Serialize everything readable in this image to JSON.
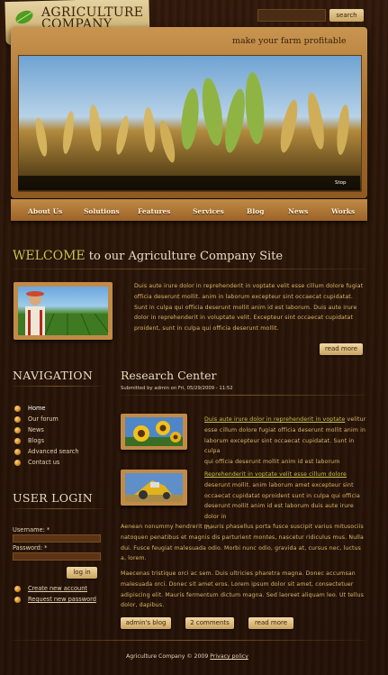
{
  "header": {
    "logo_line1": "AGRICULTURE",
    "logo_line2": "COMPANY",
    "search_label": "search",
    "tagline": "make your farm profitable"
  },
  "banner": {
    "stop_label": "Stop"
  },
  "menu": [
    "About Us",
    "Solutions",
    "Features",
    "Services",
    "Blog",
    "News",
    "Works"
  ],
  "welcome": {
    "highlight": "WELCOME",
    "rest": " to our Agriculture Company Site",
    "paragraph_lines": [
      "Duis aute irure dolor in reprehenderit in voptate velit esse cillum dolore fugiat",
      "officia deserunt mollit. anim in laborum excepteur sint occaecat cupidatat.",
      "Sunt in culpa qui officia deserunt mollit anim id est laborum. Duis aute irure",
      "dolor in reprehenderit in voluptate velit. Excepteur sint occaecat cupidatat",
      "proident, sunt in culpa qui officia deserunt mollit."
    ],
    "read_more": "read more"
  },
  "navigation": {
    "heading": "NAVIGATION",
    "items": [
      "Home",
      "Our forum",
      "News",
      "Blogs",
      "Advanced search",
      "Contact us"
    ]
  },
  "login": {
    "heading": "USER LOGIN",
    "username_label": "Username: *",
    "password_label": "Password: *",
    "login_button": "log in",
    "create_account": "Create new account",
    "request_password": "Request new password"
  },
  "research": {
    "heading": "Research Center",
    "submitted": "Submitted by admin on Fri, 05/29/2009 - 11:52",
    "entry1": {
      "link": "Duis aute irure dolor in reprehenderit in voptate",
      "line1_rest": " velitur",
      "lines": [
        "esse cillum dolore fugiat officia deserunt mollit anim in",
        "laborum excepteur sint occaecat cupidatat. Sunt in culpa",
        "qui officia deserunt mollit anim id est laborum"
      ]
    },
    "entry2": {
      "link": "Reprehenderit in voptate velit esse cillum dolore",
      "lines": [
        "deserunt mollit. anim laborum amet excepteur sint",
        "occaecat cupidatat oproident sunt in culpa qui officia",
        "deserunt mollit anim id est laborum duis aute irure dolor in",
        "in."
      ]
    },
    "para1_lines": [
      "Aenean nonummy hendrerit mauris phasellus porta fusce suscipit varius mitusociis",
      "natoquen penatibus et magnis dis parturient montes, nascetur ridiculus mus. Nulla",
      "dui. Fusce feugiat malesuada odio. Morbi nunc odio, gravida at, cursus nec, luctus",
      "a, lorem."
    ],
    "para2_lines": [
      "Maecenas tristique orci ac sem. Duis ultricies pharetra magna. Donec accumsan",
      "malesuada orci. Donec sit amet eros. Lorem ipsum dolor sit amet, consectetuer",
      "adipiscing elit. Mauris fermentum dictum magna. Sed laoreet aliquam leo. Ut tellus",
      "dolor, dapibus."
    ],
    "btn_blog": "admin's blog",
    "btn_comments": "2 comments",
    "btn_more": "read more"
  },
  "footer": {
    "text": "Agriculture Company © 2009 ",
    "link": "Privacy policy"
  }
}
